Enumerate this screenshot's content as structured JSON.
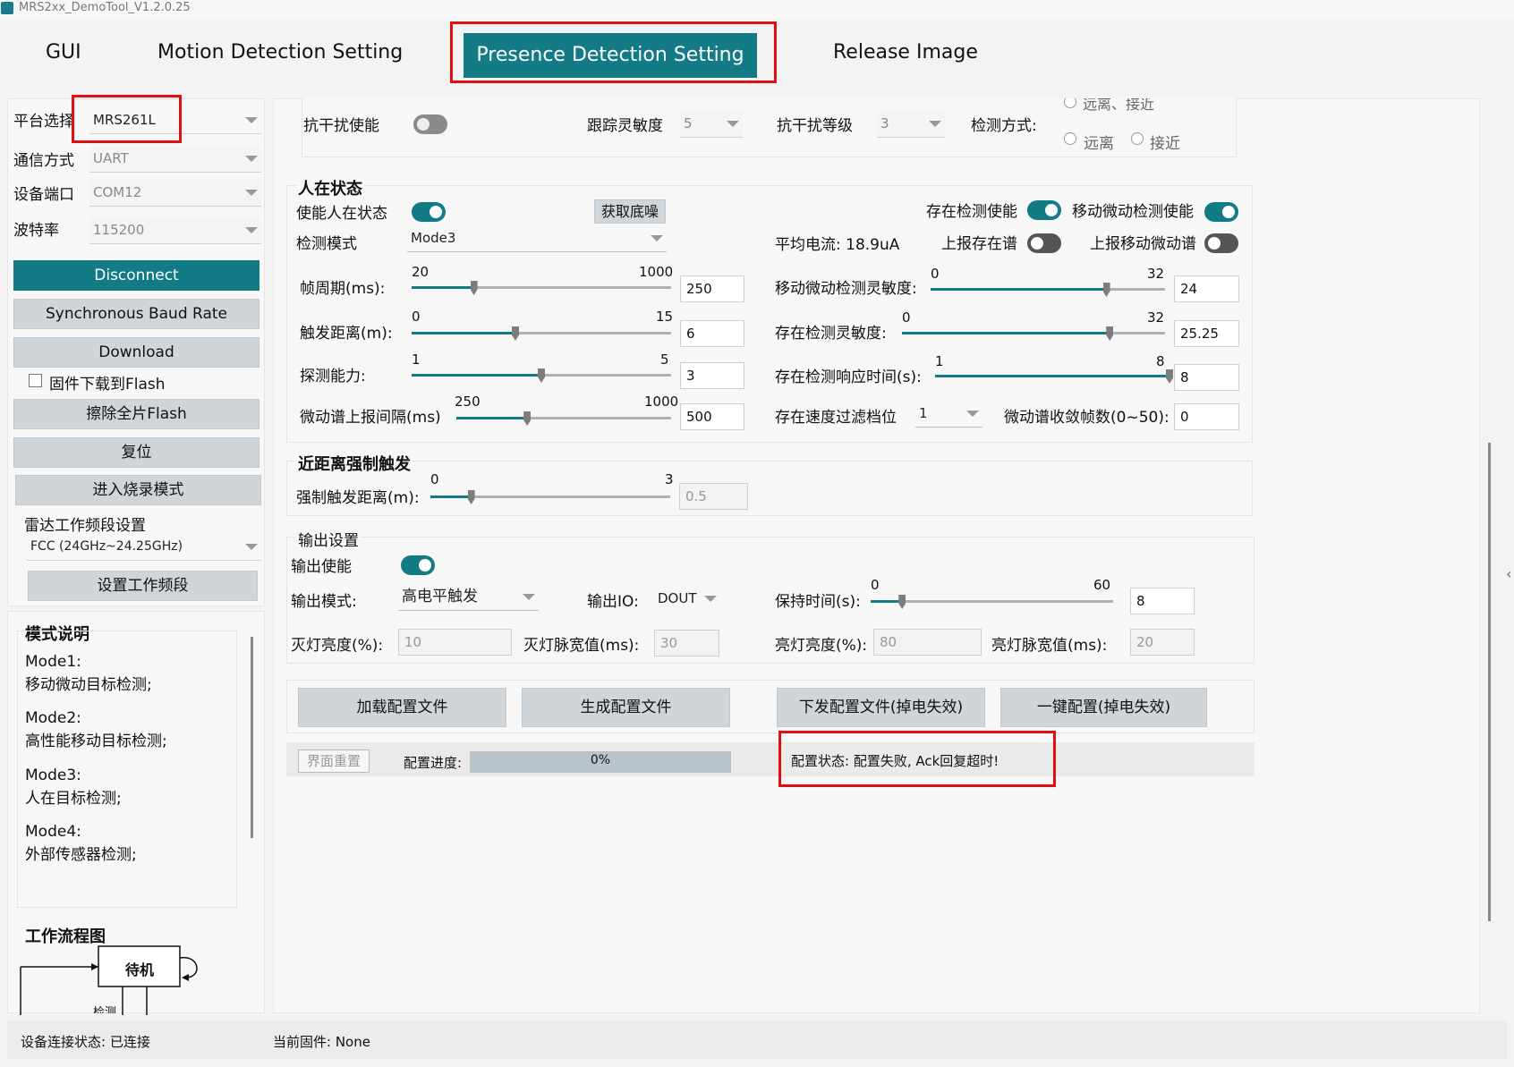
{
  "title": "MRS2xx_DemoTool_V1.2.0.25",
  "tabs": [
    "GUI",
    "Motion Detection Setting",
    "Presence Detection Setting",
    "Release Image"
  ],
  "left": {
    "platform_label": "平台选择",
    "platform_value": "MRS261L",
    "comm_label": "通信方式",
    "comm_value": "UART",
    "port_label": "设备端口",
    "port_value": "COM12",
    "baud_label": "波特率",
    "baud_value": "115200",
    "disconnect": "Disconnect",
    "sync_baud": "Synchronous Baud Rate",
    "download": "Download",
    "flash_checkbox": "固件下载到Flash",
    "erase": "擦除全片Flash",
    "reset": "复位",
    "burn_mode": "进入烧录模式",
    "band_label": "雷达工作频段设置",
    "band_value": "FCC (24GHz~24.25GHz)",
    "set_band": "设置工作频段",
    "mode_title": "模式说明",
    "modes": [
      {
        "name": "Mode1:",
        "desc": "移动微动目标检测;"
      },
      {
        "name": "Mode2:",
        "desc": "高性能移动目标检测;"
      },
      {
        "name": "Mode3:",
        "desc": "人在目标检测;"
      },
      {
        "name": "Mode4:",
        "desc": "外部传感器检测;"
      }
    ],
    "flow_title": "工作流程图",
    "flow_standby": "待机",
    "flow_detect": "检测"
  },
  "top": {
    "anti_interf_enable": "抗干扰使能",
    "track_sens_label": "跟踪灵敏度",
    "track_sens_value": "5",
    "anti_level_label": "抗干扰等级",
    "anti_level_value": "3",
    "detect_method_label": "检测方式:",
    "radio_both": "远离、接近",
    "radio_far": "远离",
    "radio_near": "接近"
  },
  "presence": {
    "title": "人在状态",
    "enable_label": "使能人在状态",
    "get_noise": "获取底噪",
    "presence_detect_enable": "存在检测使能",
    "motion_detect_enable": "移动微动检测使能",
    "mode_label": "检测模式",
    "mode_value": "Mode3",
    "avg_current": "平均电流: 18.9uA",
    "report_presence": "上报存在谱",
    "report_motion": "上报移动微动谱",
    "frame_label": "帧周期(ms):",
    "frame_min": "20",
    "frame_max": "1000",
    "frame_value": "250",
    "trigger_label": "触发距离(m):",
    "trigger_min": "0",
    "trigger_max": "15",
    "trigger_value": "6",
    "detect_label": "探测能力:",
    "detect_min": "1",
    "detect_max": "5",
    "detect_value": "3",
    "report_int_label": "微动谱上报间隔(ms)",
    "report_int_min": "250",
    "report_int_max": "1000",
    "report_int_value": "500",
    "motion_sens_label": "移动微动检测灵敏度:",
    "motion_sens_min": "0",
    "motion_sens_max": "32",
    "motion_sens_value": "24",
    "presence_sens_label": "存在检测灵敏度:",
    "presence_sens_min": "0",
    "presence_sens_max": "32",
    "presence_sens_value": "25.25",
    "resp_time_label": "存在检测响应时间(s):",
    "resp_time_min": "1",
    "resp_time_max": "8",
    "resp_time_value": "8",
    "speed_filter_label": "存在速度过滤档位",
    "speed_filter_value": "1",
    "converge_label": "微动谱收敛帧数(0~50):",
    "converge_value": "0",
    "sliders": {
      "frame": 0.24,
      "trigger": 0.4,
      "detect": 0.5,
      "report_int": 0.33,
      "motion_sens": 0.75,
      "presence_sens": 0.79,
      "resp_time": 1.0
    }
  },
  "near": {
    "title": "近距离强制触发",
    "label": "强制触发距离(m):",
    "min": "0",
    "max": "3",
    "value": "0.5",
    "slider": 0.17
  },
  "output": {
    "title": "输出设置",
    "enable_label": "输出使能",
    "mode_label": "输出模式:",
    "mode_value": "高电平触发",
    "io_label": "输出IO:",
    "io_value": "DOUT",
    "hold_label": "保持时间(s):",
    "hold_min": "0",
    "hold_max": "60",
    "hold_value": "8",
    "hold_slider": 0.13,
    "off_bright_label": "灭灯亮度(%):",
    "off_bright_value": "10",
    "off_pulse_label": "灭灯脉宽值(ms):",
    "off_pulse_value": "30",
    "on_bright_label": "亮灯亮度(%):",
    "on_bright_value": "80",
    "on_pulse_label": "亮灯脉宽值(ms):",
    "on_pulse_value": "20"
  },
  "actions": {
    "load": "加载配置文件",
    "generate": "生成配置文件",
    "send": "下发配置文件(掉电失效)",
    "one_key": "一键配置(掉电失效)"
  },
  "progress": {
    "reset_ui": "界面重置",
    "label": "配置进度:",
    "value": "0%",
    "percent": 0,
    "status": "配置状态: 配置失败, Ack回复超时!"
  },
  "statusbar": {
    "conn": "设备连接状态: 已连接",
    "firmware": "当前固件: None"
  }
}
